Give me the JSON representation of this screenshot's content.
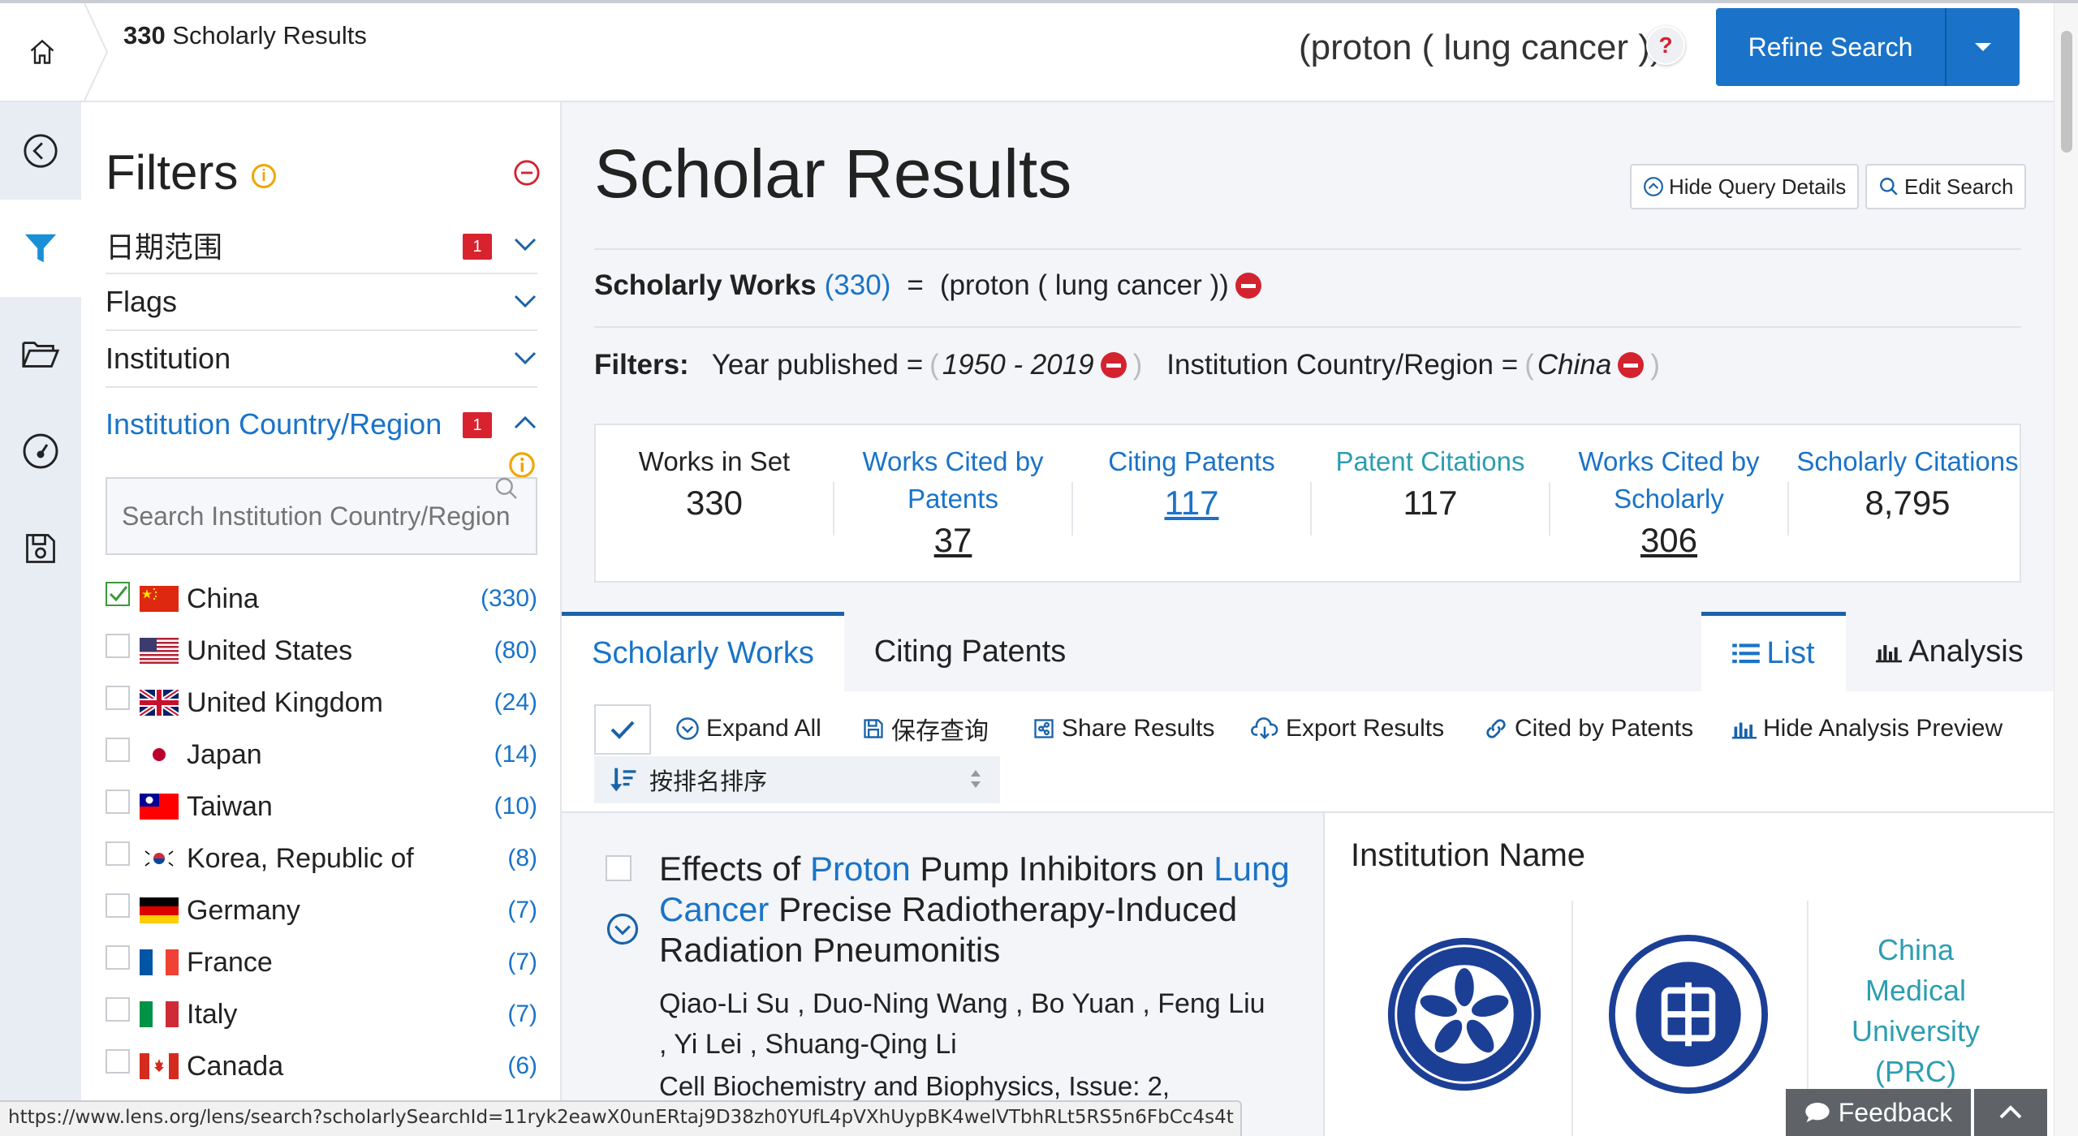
{
  "header": {
    "result_count": "330",
    "result_label": "Scholarly Results",
    "query": "(proton ( lung cancer ))",
    "help": "?",
    "refine_label": "Refine Search"
  },
  "filters": {
    "title": "Filters",
    "info": "i",
    "facets": [
      {
        "label": "日期范围",
        "badge": "1",
        "open": false
      },
      {
        "label": "Flags",
        "badge": "",
        "open": false
      },
      {
        "label": "Institution",
        "badge": "",
        "open": false
      },
      {
        "label": "Institution Country/Region",
        "badge": "1",
        "open": true
      }
    ],
    "search_placeholder": "Search Institution Country/Region",
    "countries": [
      {
        "name": "China",
        "count": "(330)",
        "checked": true
      },
      {
        "name": "United States",
        "count": "(80)",
        "checked": false
      },
      {
        "name": "United Kingdom",
        "count": "(24)",
        "checked": false
      },
      {
        "name": "Japan",
        "count": "(14)",
        "checked": false
      },
      {
        "name": "Taiwan",
        "count": "(10)",
        "checked": false
      },
      {
        "name": "Korea, Republic of",
        "count": "(8)",
        "checked": false
      },
      {
        "name": "Germany",
        "count": "(7)",
        "checked": false
      },
      {
        "name": "France",
        "count": "(7)",
        "checked": false
      },
      {
        "name": "Italy",
        "count": "(7)",
        "checked": false
      },
      {
        "name": "Canada",
        "count": "(6)",
        "checked": false
      }
    ]
  },
  "main": {
    "title": "Scholar Results",
    "hide_query": "Hide Query Details",
    "edit_search": "Edit Search",
    "works_label": "Scholarly Works",
    "works_count": "(330)",
    "equals": "=",
    "query": "(proton ( lung cancer ))",
    "filters_label": "Filters:",
    "filter1_label": "Year published =",
    "filter1_value": "1950 - 2019",
    "filter2_label": "Institution Country/Region =",
    "filter2_value": "China",
    "open_paren": "(",
    "close_paren": ")",
    "stats": [
      {
        "label": "Works in Set",
        "value": "330"
      },
      {
        "label": "Works Cited by Patents",
        "value": "37"
      },
      {
        "label": "Citing Patents",
        "value": "117"
      },
      {
        "label": "Patent Citations",
        "value": "117"
      },
      {
        "label": "Works Cited by Scholarly",
        "value": "306"
      },
      {
        "label": "Scholarly Citations",
        "value": "8,795"
      }
    ],
    "tabs": {
      "works": "Scholarly Works",
      "patents": "Citing Patents",
      "list": "List",
      "analysis": "Analysis"
    },
    "toolbar": {
      "expand_all": "Expand All",
      "save_query": "保存查询",
      "share": "Share Results",
      "export": "Export Results",
      "cited_by_patents": "Cited by Patents",
      "hide_analysis": "Hide Analysis Preview",
      "sort": "按排名排序"
    },
    "result": {
      "title_1": "Effects of",
      "title_hl1": "Proton",
      "title_2": "Pump Inhibitors on",
      "title_hl2": "Lung",
      "title_hl3": "Cancer",
      "title_3": "Precise Radiotherapy-Induced Radiation Pneumonitis",
      "authors": "Qiao-Li Su , Duo-Ning Wang , Bo Yuan , Feng Liu , Yi Lei , Shuang-Qing Li",
      "journal": "Cell Biochemistry and Biophysics,  Issue: 2,"
    },
    "analysis": {
      "title": "Institution Name",
      "inst3": "China Medical University (PRC)"
    }
  },
  "status_url": "https://www.lens.org/lens/search?scholarlySearchId=11ryk2eawX0unERtaj9D38zh0YUfL4pVXhUypBK4welVTbhRLt5RS5n6FbCc4s4t",
  "feedback": "Feedback",
  "colors": {
    "accent": "#1a73c8",
    "teal": "#2c9eb0",
    "badge": "#d8232f"
  }
}
